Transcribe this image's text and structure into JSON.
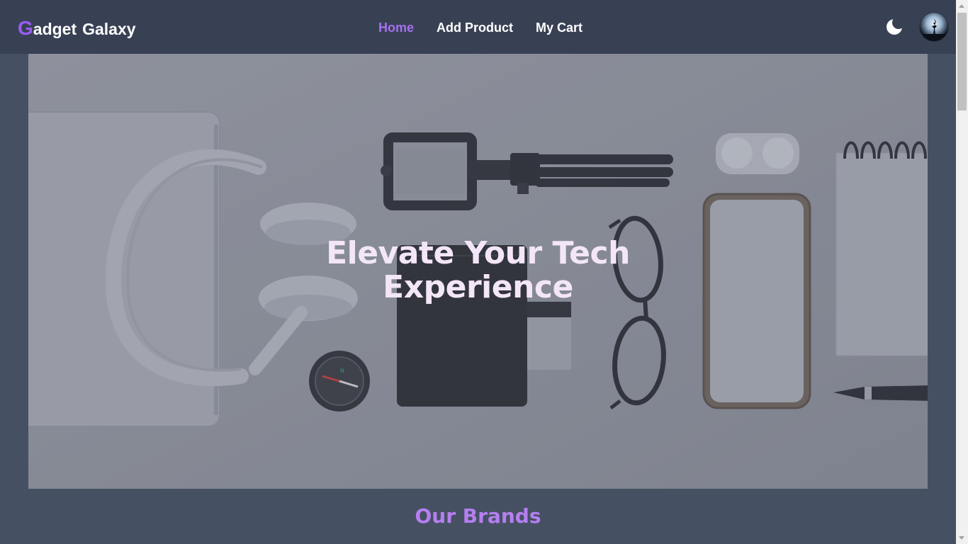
{
  "brand": {
    "first_letter": "G",
    "rest_first_word": "adget",
    "second_word": "Galaxy",
    "accent_color": "#9b5cf6"
  },
  "nav": {
    "items": [
      {
        "label": "Home",
        "active": true
      },
      {
        "label": "Add Product",
        "active": false
      },
      {
        "label": "My Cart",
        "active": false
      }
    ]
  },
  "actions": {
    "theme_icon": "moon-icon",
    "avatar_icon": "user-avatar"
  },
  "hero": {
    "title_line1": "Elevate Your Tech",
    "title_line2": "Experience"
  },
  "section": {
    "title": "Our Brands"
  },
  "colors": {
    "nav_bg": "#384154",
    "page_bg": "#465063",
    "active_link": "#a570ef",
    "section_title": "#b57ff0",
    "hero_title": "#f3e6f7"
  }
}
